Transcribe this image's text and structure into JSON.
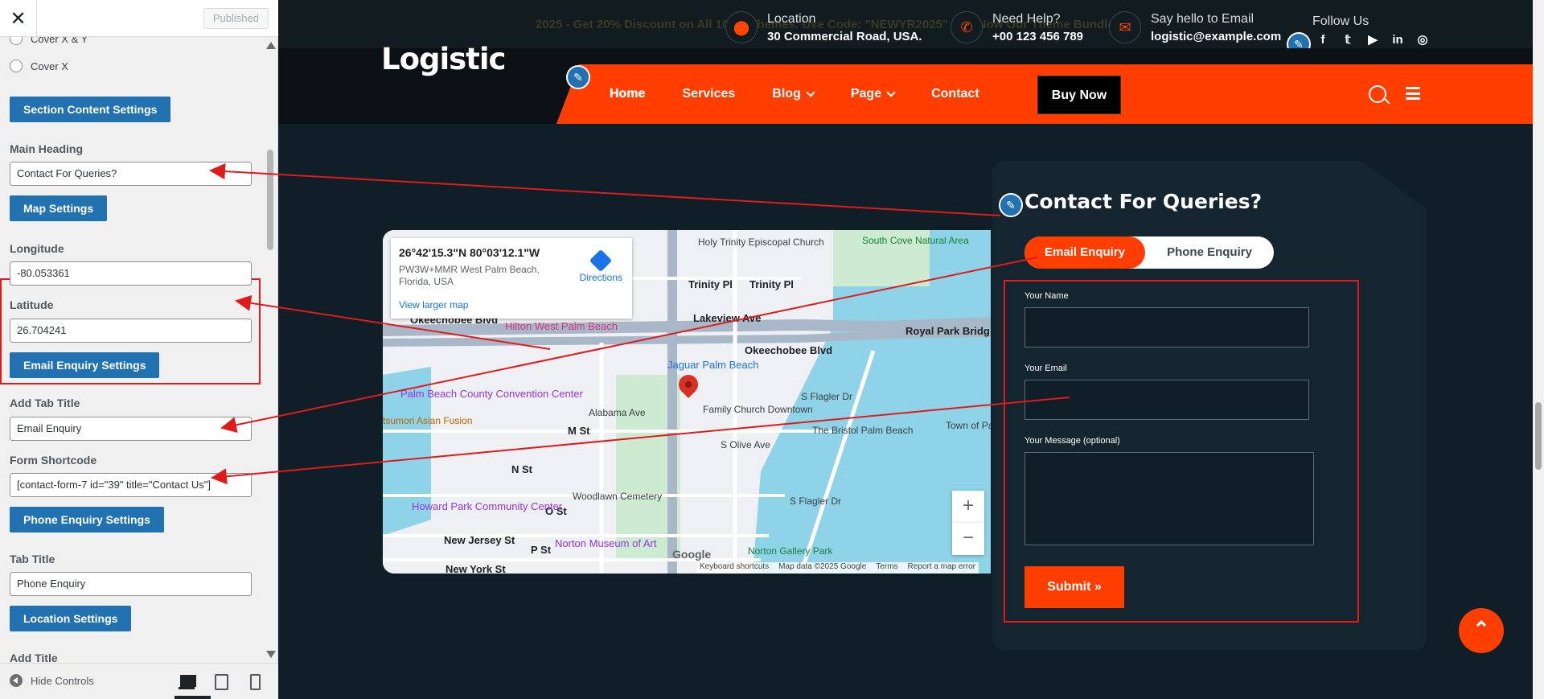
{
  "customizer": {
    "close_icon": "close-icon",
    "published_label": "Published",
    "radio_options": [
      "Cover X & Y",
      "Cover X"
    ],
    "section_content_btn": "Section Content Settings",
    "main_heading_label": "Main Heading",
    "main_heading_value": "Contact For Queries?",
    "map_settings_btn": "Map Settings",
    "longitude_label": "Longitude",
    "longitude_value": "-80.053361",
    "latitude_label": "Latitude",
    "latitude_value": "26.704241",
    "email_enquiry_btn": "Email Enquiry Settings",
    "add_tab_title_label": "Add Tab Title",
    "add_tab_title_value": "Email Enquiry",
    "form_shortcode_label": "Form Shortcode",
    "form_shortcode_value": "[contact-form-7 id=\"39\" title=\"Contact Us\"]",
    "phone_enquiry_btn": "Phone Enquiry Settings",
    "tab_title_label": "Tab Title",
    "tab_title_value": "Phone Enquiry",
    "location_settings_btn": "Location Settings",
    "add_title_label": "Add Title",
    "hide_controls": "Hide Controls"
  },
  "topbar": {
    "promo": "2025 - Get 20% Discount on All 100% Themes. Use Code: \"NEWYR2025\"  Buy Now Our Theme Bundle",
    "location_title": "Location",
    "location_value": "30 Commercial Road, USA.",
    "help_title": "Need Help?",
    "help_value": "+00 123 456 789",
    "email_title": "Say hello to Email",
    "email_value": "logistic@example.com",
    "follow_us": "Follow Us",
    "socials": [
      "f",
      "t",
      "yt",
      "in",
      "ig"
    ]
  },
  "header": {
    "logo": "Logistic",
    "nav": [
      "Home",
      "Services",
      "Blog",
      "Page",
      "Contact"
    ],
    "buy_now": "Buy Now"
  },
  "map": {
    "coords": "26°42'15.3\"N 80°03'12.1\"W",
    "address": "PW3W+MMR West Palm Beach, Florida, USA",
    "directions": "Directions",
    "view_larger": "View larger map",
    "labels": {
      "holy_trinity": "Holy Trinity Episcopal Church",
      "south_cove": "South Cove Natural Area",
      "trinity_pl1": "Trinity Pl",
      "trinity_pl2": "Trinity Pl",
      "lakeview": "Lakeview Ave",
      "hilton": "Hilton West Palm Beach",
      "okeechobee1": "Okeechobee Blvd",
      "okeechobee2": "Okeechobee Blvd",
      "royal_park": "Royal Park Bridg",
      "jaguar": "Jaguar Palm Beach",
      "palm_beach_county": "Palm Beach County Convention Center",
      "alabama": "Alabama Ave",
      "family_church": "Family Church Downtown",
      "s_flagler": "S Flagler Dr",
      "tsumori": "tsumori Asian Fusion",
      "m_st": "M St",
      "bristol": "The Bristol Palm Beach",
      "town_of": "Town of Palm Beach",
      "n_st": "N St",
      "s_olive": "S Olive Ave",
      "woodlawn": "Woodlawn Cemetery",
      "o_st": "O St",
      "howard_park": "Howard Park Community Center",
      "new_jersey": "New Jersey St",
      "p_st": "P St",
      "norton_museum": "Norton Museum of Art",
      "new_york": "New York St",
      "norton_gallery": "Norton Gallery Park",
      "s_flagler2": "S Flagler Dr"
    },
    "footer": [
      "Keyboard shortcuts",
      "Map data ©2025 Google",
      "Terms",
      "Report a map error"
    ],
    "google": "Google",
    "zoom_in": "+",
    "zoom_out": "−"
  },
  "contact": {
    "title": "Contact For Queries?",
    "tab_email": "Email Enquiry",
    "tab_phone": "Phone Enquiry",
    "name_label": "Your Name",
    "email_label": "Your Email",
    "message_label": "Your Message (optional)",
    "submit": "Submit »"
  }
}
